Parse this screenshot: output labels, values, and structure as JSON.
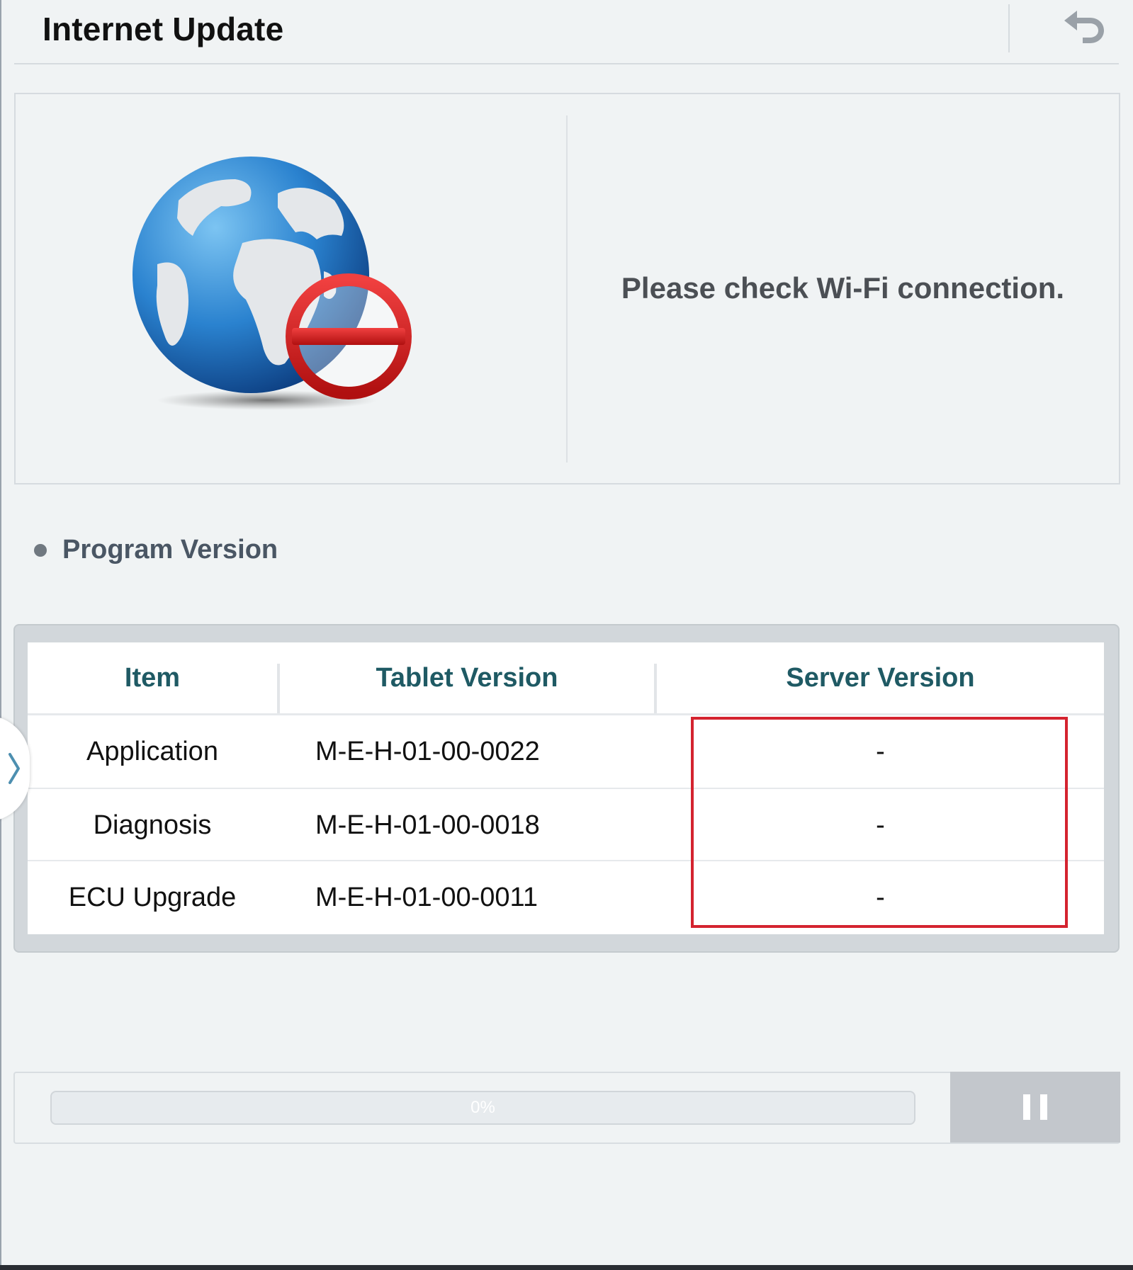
{
  "header": {
    "title": "Internet Update",
    "back_icon": "back-arrow-icon"
  },
  "status": {
    "icon": "globe-no-connection-icon",
    "message": "Please check Wi-Fi connection."
  },
  "section": {
    "title": "Program Version"
  },
  "table": {
    "columns": [
      "Item",
      "Tablet Version",
      "Server Version"
    ],
    "rows": [
      {
        "item": "Application",
        "tablet_version": "M-E-H-01-00-0022",
        "server_version": "-"
      },
      {
        "item": "Diagnosis",
        "tablet_version": "M-E-H-01-00-0018",
        "server_version": "-"
      },
      {
        "item": "ECU Upgrade",
        "tablet_version": "M-E-H-01-00-0011",
        "server_version": "-"
      }
    ],
    "header_color": "#1f5a64",
    "highlight_color": "#d4232f"
  },
  "progress": {
    "percent": 0,
    "label": "0%"
  },
  "side_handle": {
    "icon": "chevron-right-icon"
  },
  "controls": {
    "pause_icon": "pause-icon"
  }
}
